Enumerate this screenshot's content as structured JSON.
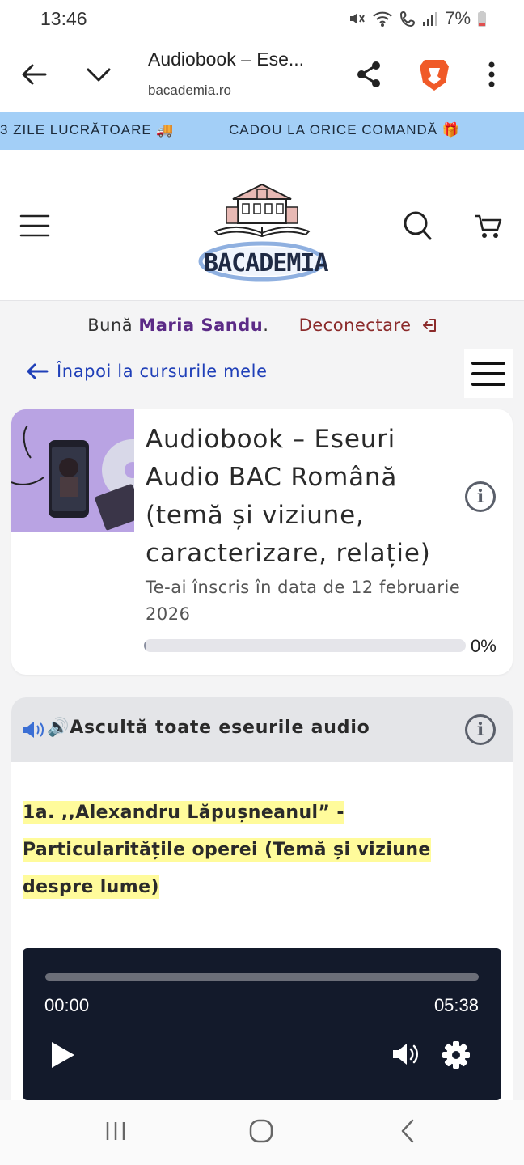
{
  "status": {
    "time": "13:46",
    "battery": "7%"
  },
  "browser": {
    "title": "Audiobook – Ese...",
    "domain": "bacademia.ro"
  },
  "marquee": [
    "3 ZILE LUCRĂTOARE 🚚",
    "CADOU LA ORICE COMANDĂ 🎁"
  ],
  "site": {
    "logo_text": "BACADEMIA"
  },
  "greeting": {
    "hello": "Bună",
    "name": "Maria Sandu",
    "dot": ".",
    "logout": "Deconectare"
  },
  "back_link": "Înapoi la cursurile mele",
  "course": {
    "title": "Audiobook – Eseuri Audio BAC Română (temă și viziune, caracterizare, relație)",
    "enrolled": "Te-ai înscris în data de 12 februarie 2026",
    "progress": 0,
    "progress_label": "0%"
  },
  "section": {
    "title": "🔊Ascultă toate eseurile audio",
    "lesson_title": "1a. ,,Alexandru Lăpușneanul” - Particularitățile operei (Temă și viziune despre lume)"
  },
  "player": {
    "current_time": "00:00",
    "duration": "05:38",
    "played_fraction": 0
  },
  "colors": {
    "marquee_bg": "#a3cff7",
    "player_bg": "#131a2b",
    "highlight": "#fffb9b",
    "name_purple": "#5b2a86",
    "logout_red": "#8b2a2a",
    "link_blue": "#1f3fb8"
  }
}
